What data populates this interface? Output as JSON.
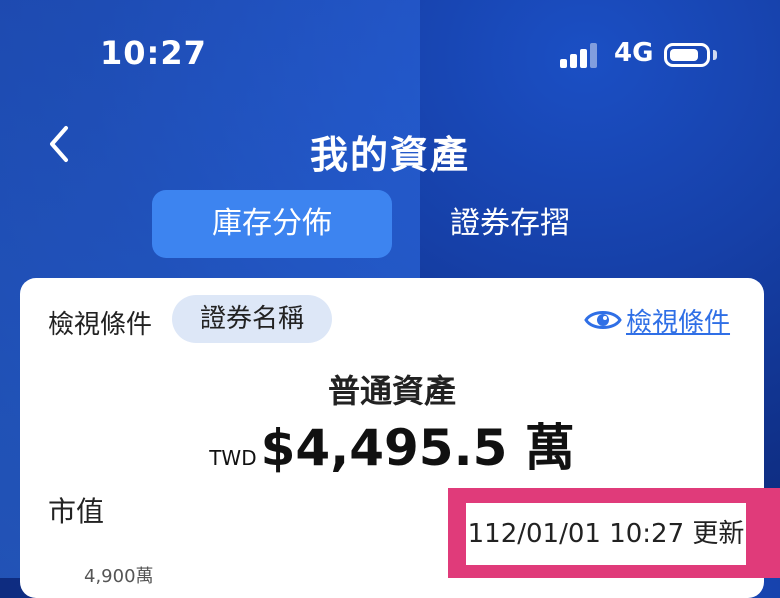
{
  "status_bar": {
    "time": "10:27",
    "network": "4G"
  },
  "header": {
    "title": "我的資產"
  },
  "tabs": [
    {
      "label": "庫存分佈",
      "active": true
    },
    {
      "label": "證券存摺",
      "active": false
    }
  ],
  "card": {
    "filter_label": "檢視條件",
    "filter_chip": "證券名稱",
    "view_link": "檢視條件",
    "asset_title": "普通資產",
    "currency": "TWD",
    "amount": "$4,495.5 萬",
    "market_value_label": "市值",
    "y_axis_tick": "4,900萬",
    "update_time": "112/01/01 10:27 更新"
  },
  "colors": {
    "accent": "#2f6fe6",
    "highlight": "#e03b7a",
    "tab_active": "#3d84f0",
    "chip_bg": "#dde7f7"
  }
}
